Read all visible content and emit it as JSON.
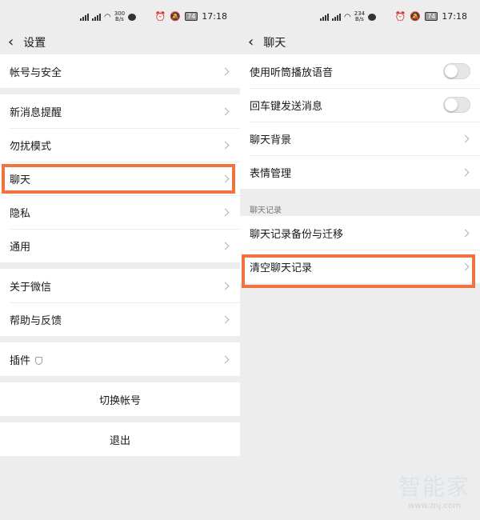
{
  "status_left": {
    "net_speed_value": "300",
    "net_speed_unit": "B/s",
    "time": "17:18",
    "battery": "74"
  },
  "status_right": {
    "net_speed_value": "234",
    "net_speed_unit": "B/s",
    "time": "17:18",
    "battery": "74"
  },
  "settings": {
    "title": "设置",
    "items": {
      "account_security": "帐号与安全",
      "new_message_alert": "新消息提醒",
      "do_not_disturb": "勿扰模式",
      "chat": "聊天",
      "privacy": "隐私",
      "general": "通用",
      "about": "关于微信",
      "help_feedback": "帮助与反馈",
      "plugins": "插件"
    },
    "switch_account": "切换帐号",
    "logout": "退出"
  },
  "chat_settings": {
    "title": "聊天",
    "earpiece_voice": "使用听筒播放语音",
    "enter_to_send": "回车键发送消息",
    "chat_background": "聊天背景",
    "sticker_management": "表情管理",
    "section_chat_history": "聊天记录",
    "history_backup_migrate": "聊天记录备份与迁移",
    "clear_history": "清空聊天记录",
    "toggles": {
      "earpiece_voice_on": false,
      "enter_to_send_on": false
    }
  },
  "watermark": {
    "brand": "智能家",
    "url": "www.znj.com"
  },
  "colors": {
    "highlight": "#f0723c",
    "background": "#ededed"
  }
}
